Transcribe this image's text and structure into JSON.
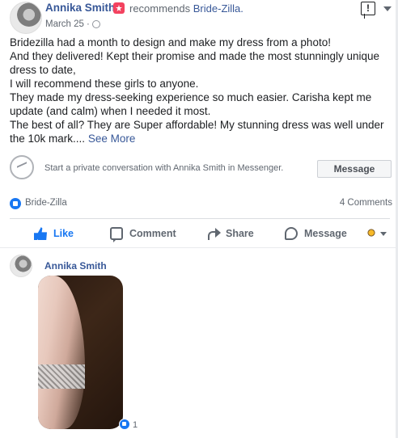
{
  "header": {
    "author": "Annika Smith",
    "action": "recommends",
    "page": "Bride-Zilla.",
    "date": "March 25",
    "separator": "·"
  },
  "post": {
    "lines": [
      "Bridezilla had a month to design and make my dress from a photo!",
      "And they delivered! Kept their promise and made the most stunningly unique dress to date,",
      "I will recommend these girls to anyone.",
      "They made my dress-seeking experience so much easier. Carisha kept me update (and calm) when I needed it most.",
      "The best of all? They are Super affordable! My stunning dress was well under the 10k mark...."
    ],
    "see_more": "See More"
  },
  "messenger": {
    "prompt": "Start a private conversation with Annika Smith in Messenger.",
    "button": "Message"
  },
  "summary": {
    "page": "Bride-Zilla",
    "comments": "4 Comments"
  },
  "actions": {
    "like": "Like",
    "comment": "Comment",
    "share": "Share",
    "message": "Message"
  },
  "comment": {
    "author": "Annika Smith",
    "reaction_count": "1"
  },
  "colors": {
    "link": "#385898",
    "like_blue": "#1877f2",
    "secondary_text": "#606770"
  }
}
